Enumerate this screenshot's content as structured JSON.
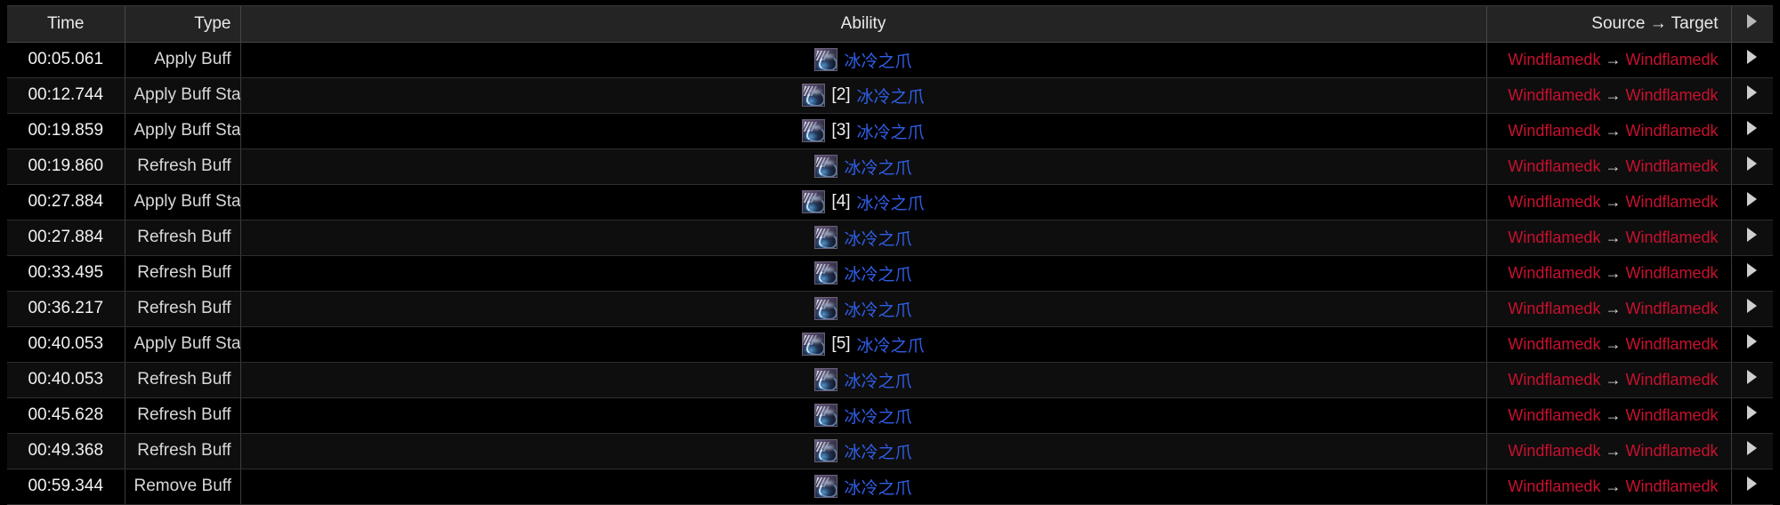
{
  "table": {
    "columns": [
      {
        "key": "time",
        "label": "Time"
      },
      {
        "key": "type",
        "label": "Type"
      },
      {
        "key": "ability",
        "label": "Ability"
      },
      {
        "key": "source",
        "label": "Source → Target"
      },
      {
        "key": "expand",
        "label": ""
      }
    ],
    "header_expand_icon": "play-triangle-icon",
    "row_expand_icon": "play-triangle-icon",
    "arrow_glyph": "→",
    "ability_icon_name": "chilled-claw-ability-icon",
    "rows": [
      {
        "time": "00:05.061",
        "type": "Apply Buff",
        "ability": {
          "stack": "",
          "name": "冰冷之爪"
        },
        "source": "Windflamedk",
        "target": "Windflamedk"
      },
      {
        "time": "00:12.744",
        "type": "Apply Buff Stack",
        "ability": {
          "stack": "[2]",
          "name": "冰冷之爪"
        },
        "source": "Windflamedk",
        "target": "Windflamedk"
      },
      {
        "time": "00:19.859",
        "type": "Apply Buff Stack",
        "ability": {
          "stack": "[3]",
          "name": "冰冷之爪"
        },
        "source": "Windflamedk",
        "target": "Windflamedk"
      },
      {
        "time": "00:19.860",
        "type": "Refresh Buff",
        "ability": {
          "stack": "",
          "name": "冰冷之爪"
        },
        "source": "Windflamedk",
        "target": "Windflamedk"
      },
      {
        "time": "00:27.884",
        "type": "Apply Buff Stack",
        "ability": {
          "stack": "[4]",
          "name": "冰冷之爪"
        },
        "source": "Windflamedk",
        "target": "Windflamedk"
      },
      {
        "time": "00:27.884",
        "type": "Refresh Buff",
        "ability": {
          "stack": "",
          "name": "冰冷之爪"
        },
        "source": "Windflamedk",
        "target": "Windflamedk"
      },
      {
        "time": "00:33.495",
        "type": "Refresh Buff",
        "ability": {
          "stack": "",
          "name": "冰冷之爪"
        },
        "source": "Windflamedk",
        "target": "Windflamedk"
      },
      {
        "time": "00:36.217",
        "type": "Refresh Buff",
        "ability": {
          "stack": "",
          "name": "冰冷之爪"
        },
        "source": "Windflamedk",
        "target": "Windflamedk"
      },
      {
        "time": "00:40.053",
        "type": "Apply Buff Stack",
        "ability": {
          "stack": "[5]",
          "name": "冰冷之爪"
        },
        "source": "Windflamedk",
        "target": "Windflamedk"
      },
      {
        "time": "00:40.053",
        "type": "Refresh Buff",
        "ability": {
          "stack": "",
          "name": "冰冷之爪"
        },
        "source": "Windflamedk",
        "target": "Windflamedk"
      },
      {
        "time": "00:45.628",
        "type": "Refresh Buff",
        "ability": {
          "stack": "",
          "name": "冰冷之爪"
        },
        "source": "Windflamedk",
        "target": "Windflamedk"
      },
      {
        "time": "00:49.368",
        "type": "Refresh Buff",
        "ability": {
          "stack": "",
          "name": "冰冷之爪"
        },
        "source": "Windflamedk",
        "target": "Windflamedk"
      },
      {
        "time": "00:59.344",
        "type": "Remove Buff",
        "ability": {
          "stack": "",
          "name": "冰冷之爪"
        },
        "source": "Windflamedk",
        "target": "Windflamedk"
      }
    ]
  },
  "colors": {
    "header_bg": "#242424",
    "row_even_bg": "#000000",
    "row_odd_bg": "#0e0e0e",
    "border": "#3c3c3c",
    "time_text": "#f2f2f2",
    "type_text": "#d8d8d8",
    "ability_link": "#2f5fe8",
    "stack_text": "#f0f0f0",
    "player_name": "#c8102e",
    "arrow": "#d9d9d9"
  }
}
